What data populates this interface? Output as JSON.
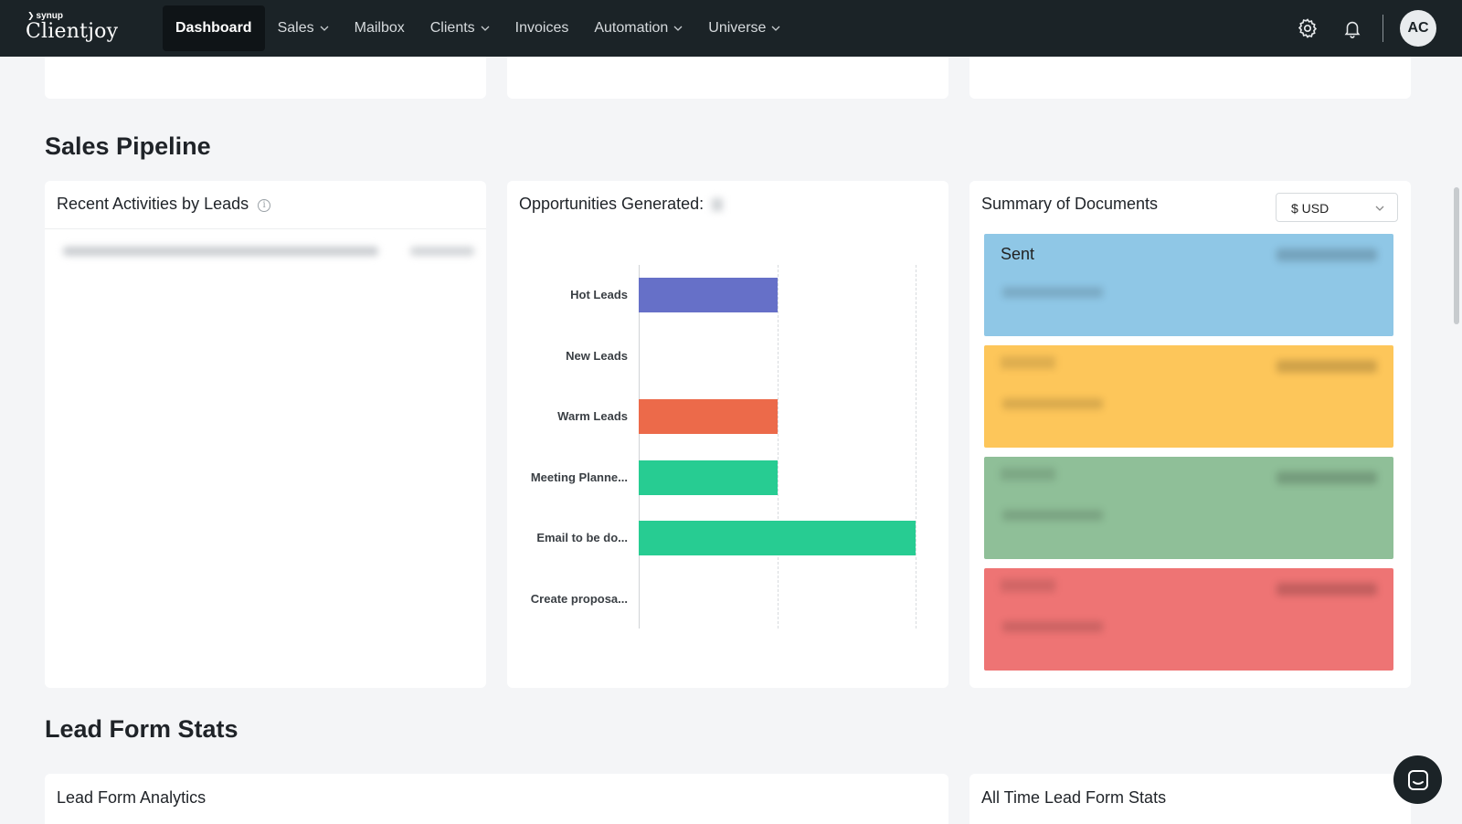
{
  "brand": {
    "small": "synup",
    "name": "Clientjoy"
  },
  "nav": {
    "items": [
      {
        "label": "Dashboard",
        "active": true,
        "dropdown": false
      },
      {
        "label": "Sales",
        "dropdown": true
      },
      {
        "label": "Mailbox",
        "dropdown": false
      },
      {
        "label": "Clients",
        "dropdown": true
      },
      {
        "label": "Invoices",
        "dropdown": false
      },
      {
        "label": "Automation",
        "dropdown": true
      },
      {
        "label": "Universe",
        "dropdown": true
      }
    ],
    "settings_icon": "gear-icon",
    "notifications_icon": "bell-icon",
    "avatar_initials": "AC"
  },
  "sections": {
    "sales_pipeline": "Sales Pipeline",
    "lead_form_stats": "Lead Form Stats"
  },
  "cards": {
    "recent_activities": {
      "title": "Recent Activities by Leads"
    },
    "opportunities": {
      "title": "Opportunities Generated:"
    },
    "summary_documents": {
      "title": "Summary of Documents",
      "currency": "$ USD"
    },
    "lead_form_analytics": {
      "title": "Lead Form Analytics"
    },
    "all_time_lead_stats": {
      "title": "All Time Lead Form Stats"
    }
  },
  "documents": [
    {
      "label": "Sent",
      "color": "#8fc7e6"
    },
    {
      "label": "",
      "color": "#fdc65a"
    },
    {
      "label": "",
      "color": "#8fbf98"
    },
    {
      "label": "",
      "color": "#ee7474"
    }
  ],
  "chart_data": {
    "type": "bar",
    "orientation": "horizontal",
    "categories": [
      "Hot Leads",
      "New Leads",
      "Warm Leads",
      "Meeting Planne...",
      "Email to be do...",
      "Create proposa..."
    ],
    "values": [
      1,
      0,
      1,
      1,
      2,
      0
    ],
    "colors": [
      "#6670c8",
      "#cccccc",
      "#ec6a4a",
      "#27cc92",
      "#27cc92",
      "#cccccc"
    ],
    "xlim": [
      0,
      2
    ],
    "grid": true
  },
  "colors": {
    "nav_bg": "#1b2327",
    "page_bg": "#f4f5f7"
  }
}
